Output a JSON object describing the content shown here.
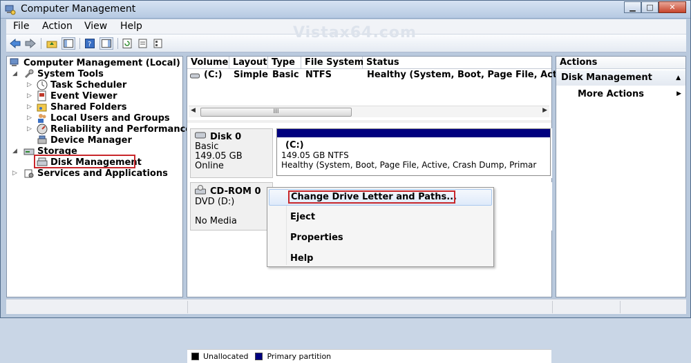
{
  "window": {
    "title": "Computer Management",
    "watermark": "Vistax64.com"
  },
  "menu": {
    "file": "File",
    "action": "Action",
    "view": "View",
    "help": "Help"
  },
  "tree": {
    "root": "Computer Management (Local)",
    "system_tools": "System Tools",
    "task_scheduler": "Task Scheduler",
    "event_viewer": "Event Viewer",
    "shared_folders": "Shared Folders",
    "local_users": "Local Users and Groups",
    "reliability": "Reliability and Performance",
    "device_manager": "Device Manager",
    "storage": "Storage",
    "disk_management": "Disk Management",
    "services": "Services and Applications"
  },
  "volume_list": {
    "headers": [
      "Volume",
      "Layout",
      "Type",
      "File System",
      "Status"
    ],
    "row": {
      "volume": "(C:)",
      "layout": "Simple",
      "type": "Basic",
      "fs": "NTFS",
      "status": "Healthy (System, Boot, Page File, Active"
    }
  },
  "disk0": {
    "name": "Disk 0",
    "kind": "Basic",
    "size": "149.05 GB",
    "state": "Online",
    "partition": {
      "label": "(C:)",
      "detail": "149.05 GB NTFS",
      "status": "Healthy (System, Boot, Page File, Active, Crash Dump, Primar"
    }
  },
  "cdrom0": {
    "name": "CD-ROM 0",
    "drive": "DVD (D:)",
    "media": "No Media"
  },
  "context_menu": {
    "change_letter": "Change Drive Letter and Paths...",
    "eject": "Eject",
    "properties": "Properties",
    "help": "Help"
  },
  "legend": {
    "unallocated": "Unallocated",
    "primary": "Primary partition",
    "unallocated_color": "#000000",
    "primary_color": "#00007f"
  },
  "actions": {
    "header": "Actions",
    "section": "Disk Management",
    "more": "More Actions"
  },
  "hscroll_thumb": "III",
  "colors": {
    "accent": "#00007f",
    "highlight_border": "#c8262a"
  }
}
